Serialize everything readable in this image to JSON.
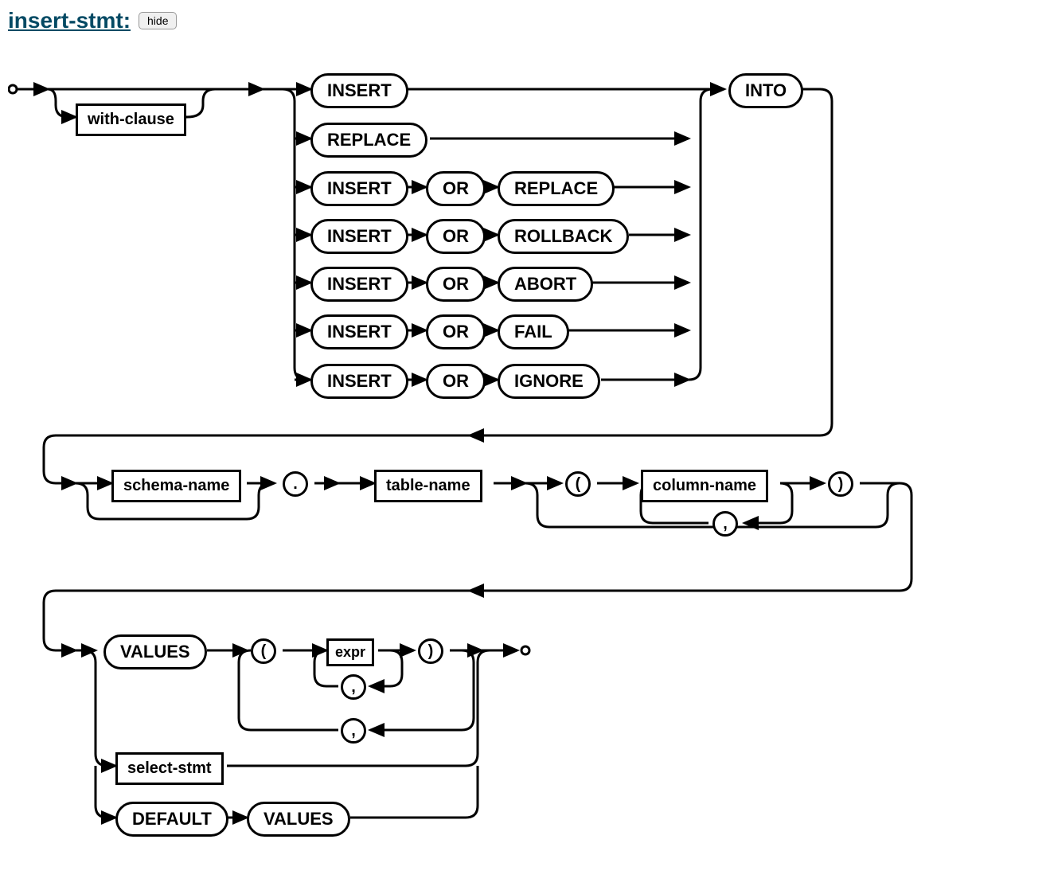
{
  "header": {
    "title": "insert-stmt:",
    "button": "hide"
  },
  "nodes": {
    "with_clause": "with-clause",
    "insert1": "INSERT",
    "replace": "REPLACE",
    "insert2": "INSERT",
    "or2": "OR",
    "replace2": "REPLACE",
    "insert3": "INSERT",
    "or3": "OR",
    "rollback": "ROLLBACK",
    "insert4": "INSERT",
    "or4": "OR",
    "abort": "ABORT",
    "insert5": "INSERT",
    "or5": "OR",
    "fail": "FAIL",
    "insert6": "INSERT",
    "or6": "OR",
    "ignore": "IGNORE",
    "into": "INTO",
    "schema_name": "schema-name",
    "dot": ".",
    "table_name": "table-name",
    "lparen1": "(",
    "column_name": "column-name",
    "rparen1": ")",
    "comma1": ",",
    "values": "VALUES",
    "lparen2": "(",
    "expr": "expr",
    "rparen2": ")",
    "comma2": ",",
    "comma3": ",",
    "select_stmt": "select-stmt",
    "default": "DEFAULT",
    "values2": "VALUES"
  }
}
